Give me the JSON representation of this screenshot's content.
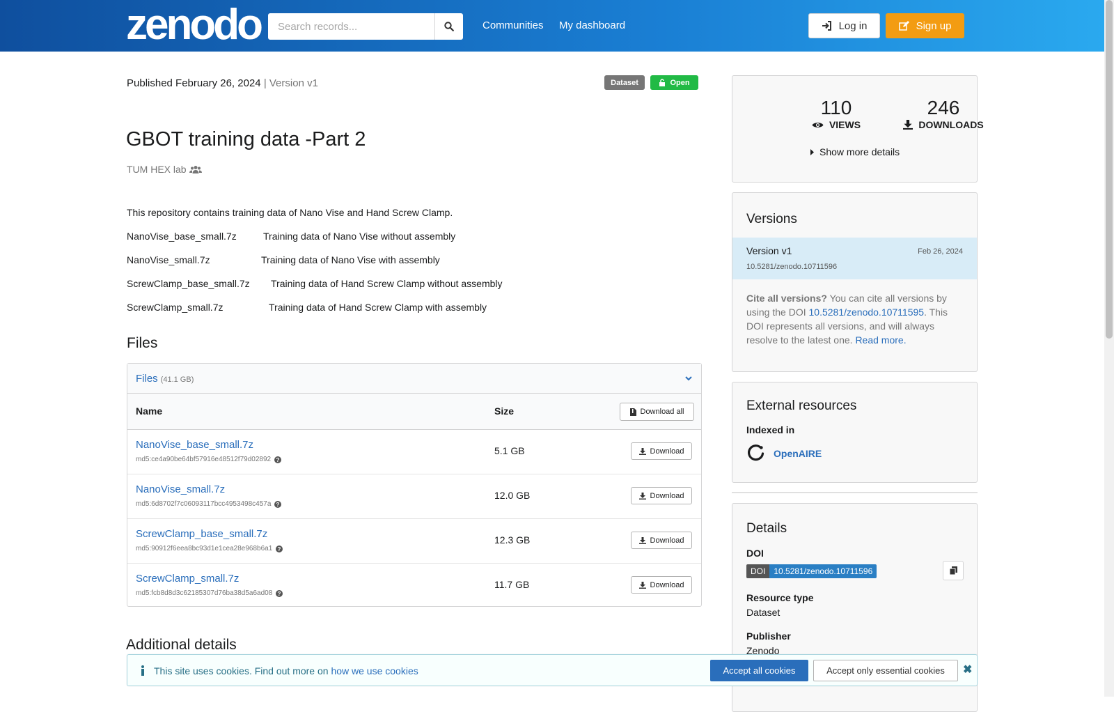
{
  "header": {
    "logo": "zenodo",
    "search_placeholder": "Search records...",
    "nav": [
      "Communities",
      "My dashboard"
    ],
    "login": "Log in",
    "signup": "Sign up"
  },
  "record": {
    "published": "Published February 26, 2024",
    "version": "| Version v1",
    "badge_type": "Dataset",
    "badge_access": "Open",
    "title": "GBOT training data -Part 2",
    "creator": "TUM HEX lab",
    "description": {
      "intro": "This repository contains training data of Nano Vise and Hand Screw Clamp.",
      "items": [
        {
          "file": "NanoVise_base_small.7z",
          "text": "Training data of Nano Vise without assembly"
        },
        {
          "file": "NanoVise_small.7z",
          "text": "Training data of Nano Vise with assembly"
        },
        {
          "file": "ScrewClamp_base_small.7z",
          "text": "Training data of Hand Screw Clamp without assembly"
        },
        {
          "file": "ScrewClamp_small.7z",
          "text": "Training data of Hand Screw Clamp with assembly"
        }
      ]
    }
  },
  "files": {
    "heading": "Files",
    "panel_title": "Files",
    "panel_size": "(41.1 GB)",
    "col_name": "Name",
    "col_size": "Size",
    "download_all": "Download all",
    "download": "Download",
    "rows": [
      {
        "name": "NanoVise_base_small.7z",
        "md5": "md5:ce4a90be64bf57916e48512f79d02892",
        "size": "5.1 GB"
      },
      {
        "name": "NanoVise_small.7z",
        "md5": "md5:6d8702f7c06093117bcc4953498c457a",
        "size": "12.0 GB"
      },
      {
        "name": "ScrewClamp_base_small.7z",
        "md5": "md5:90912f6eea8bc93d1e1cea28e968b6a1",
        "size": "12.3 GB"
      },
      {
        "name": "ScrewClamp_small.7z",
        "md5": "md5:fcb8d8d3c62185307d76ba38d5a6ad08",
        "size": "11.7 GB"
      }
    ]
  },
  "additional_details": "Additional details",
  "stats": {
    "views": "110",
    "views_label": "VIEWS",
    "downloads": "246",
    "downloads_label": "DOWNLOADS",
    "more": "Show more details"
  },
  "versions": {
    "heading": "Versions",
    "current_label": "Version v1",
    "current_date": "Feb 26, 2024",
    "current_doi": "10.5281/zenodo.10711596",
    "cite_bold": "Cite all versions?",
    "cite_pre": " You can cite all versions by using the DOI ",
    "cite_doi": "10.5281/zenodo.10711595",
    "cite_post": ". This DOI represents all versions, and will always resolve to the latest one. ",
    "read_more": "Read more."
  },
  "external": {
    "heading": "External resources",
    "indexed": "Indexed in",
    "openaire": "OpenAIRE"
  },
  "details": {
    "heading": "Details",
    "doi_label": "DOI",
    "doi_badge_left": "DOI",
    "doi_value": "10.5281/zenodo.10711596",
    "resource_type_label": "Resource type",
    "resource_type": "Dataset",
    "publisher_label": "Publisher",
    "publisher": "Zenodo"
  },
  "cookie": {
    "text": "This site uses cookies. Find out more on ",
    "link": "how we use cookies",
    "accept_all": "Accept all cookies",
    "accept_essential": "Accept only essential cookies"
  },
  "colors": {
    "accent": "#2a6ebb",
    "signup": "#f39c12",
    "open_badge": "#21ba45",
    "dataset_badge": "#767676"
  }
}
